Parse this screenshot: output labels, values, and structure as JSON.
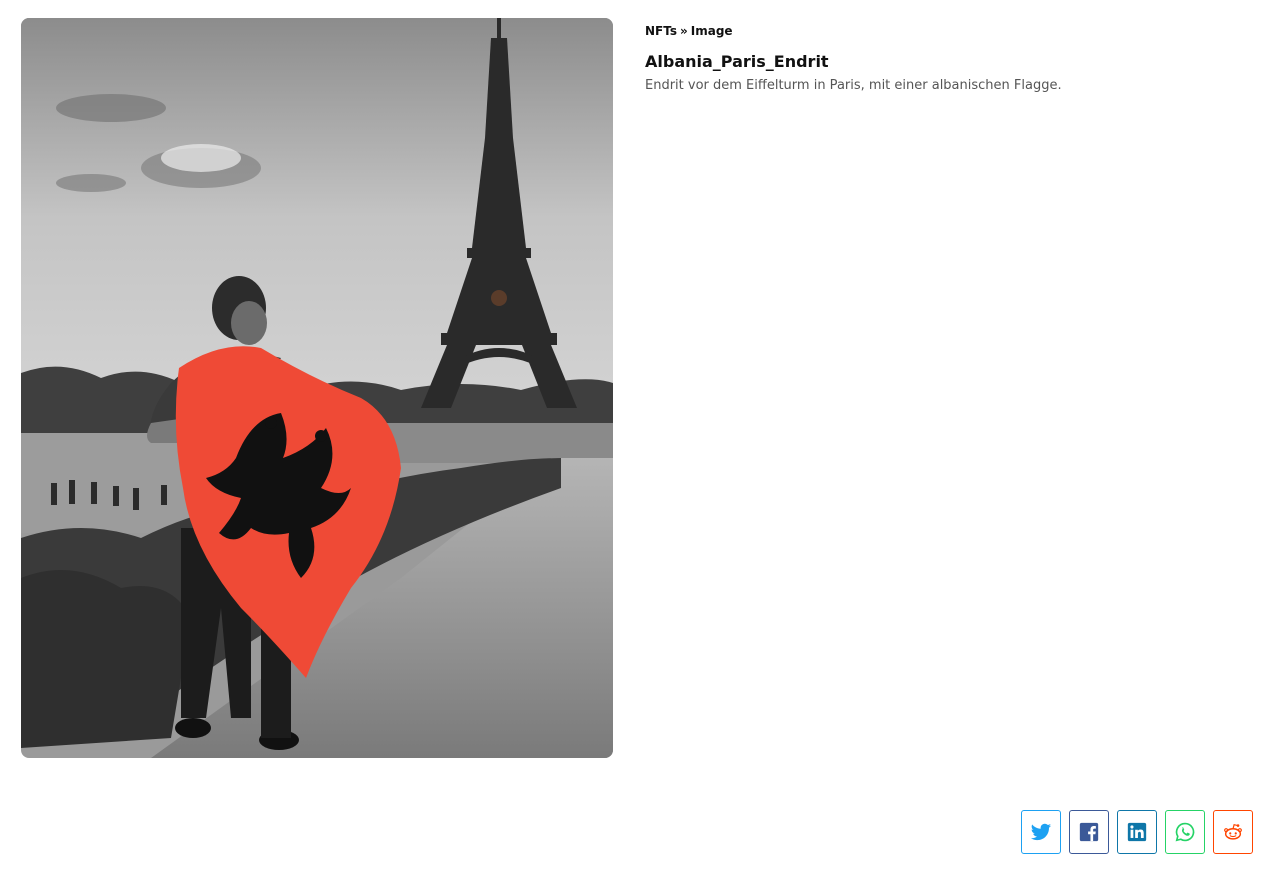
{
  "breadcrumb": {
    "root": "NFTs",
    "separator": "»",
    "current": "Image"
  },
  "nft": {
    "title": "Albania_Paris_Endrit",
    "description": "Endrit vor dem Eiffelturm in Paris, mit einer albanischen Flagge."
  },
  "share": [
    {
      "name": "twitter-icon",
      "color": "#1da1f2"
    },
    {
      "name": "facebook-icon",
      "color": "#3b5998"
    },
    {
      "name": "linkedin-icon",
      "color": "#0e76a8"
    },
    {
      "name": "whatsapp-icon",
      "color": "#25d366"
    },
    {
      "name": "reddit-icon",
      "color": "#ff4500"
    }
  ],
  "colors": {
    "flag_red": "#ef4a36",
    "text_primary": "#111111",
    "text_muted": "#555555"
  }
}
